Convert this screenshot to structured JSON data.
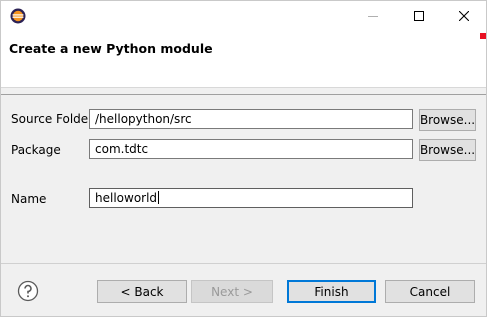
{
  "titlebar": {
    "icon": "eclipse-icon",
    "controls": [
      "minimize-icon",
      "maximize-icon",
      "close-icon"
    ]
  },
  "header": {
    "title": "Create a new Python module"
  },
  "form": {
    "source_folder": {
      "label": "Source Folder",
      "value": "/hellopython/src",
      "browse": "Browse..."
    },
    "package": {
      "label": "Package",
      "value": "com.tdtc",
      "browse": "Browse..."
    },
    "name": {
      "label": "Name",
      "value": "helloworld"
    }
  },
  "footer": {
    "help_icon": "help-icon",
    "back": "< Back",
    "next": "Next >",
    "finish": "Finish",
    "cancel": "Cancel"
  },
  "colors": {
    "accent": "#e81123",
    "default_button_border": "#0078d7"
  }
}
